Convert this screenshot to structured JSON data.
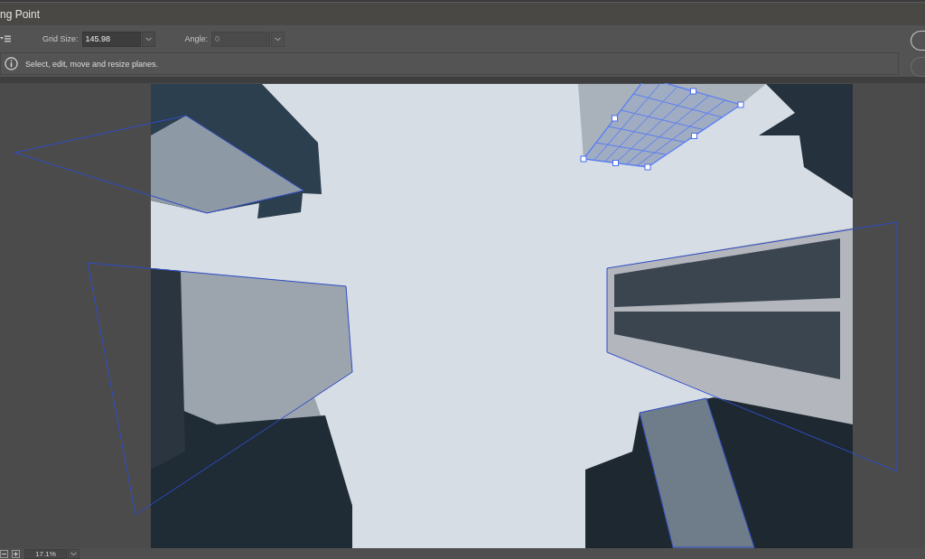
{
  "window": {
    "title": "ng Point"
  },
  "toolbar": {
    "fields": [
      {
        "label": "Grid Size:",
        "value": "145.98",
        "disabled": false
      },
      {
        "label": "Angle:",
        "value": "0",
        "disabled": true
      }
    ]
  },
  "info_bar": {
    "message": "Select, edit, move and resize planes."
  },
  "dialog_buttons": [
    {
      "default": true
    },
    {
      "default": false
    }
  ],
  "planes": [
    {
      "selected": false
    },
    {
      "selected": false
    },
    {
      "selected": true
    },
    {
      "selected": false
    },
    {
      "selected": false
    }
  ],
  "status_bar": {
    "zoom": "17.1%"
  }
}
